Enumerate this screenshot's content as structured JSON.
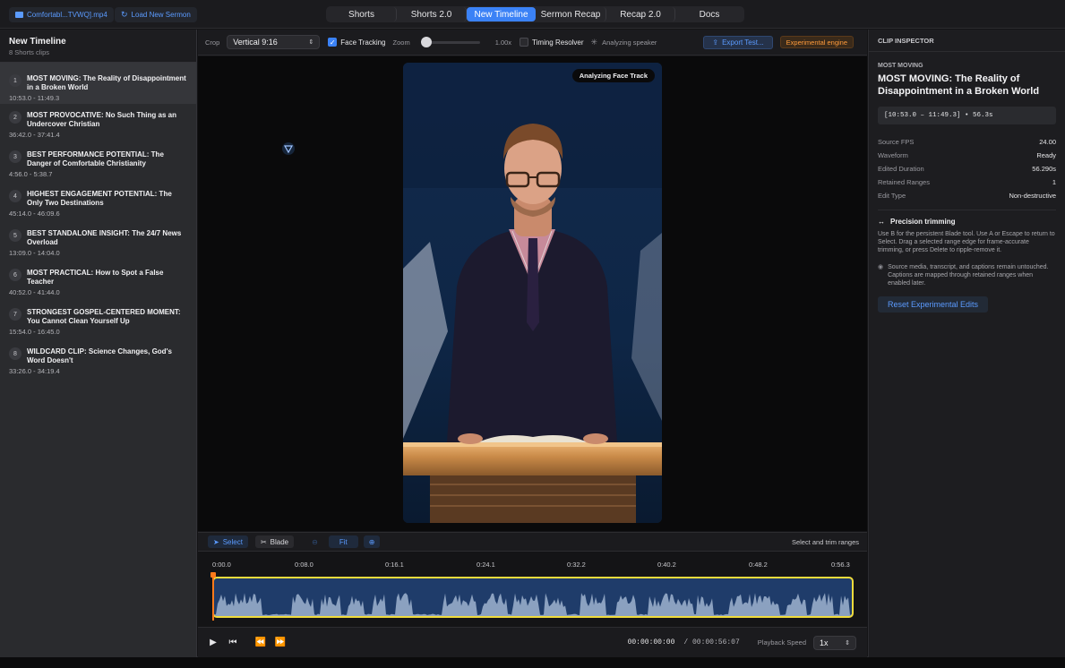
{
  "topbar": {
    "file_label": "Comfortabl...TVWQ].mp4",
    "load_label": "Load New Sermon",
    "tabs": [
      {
        "label": "Shorts"
      },
      {
        "label": "Shorts 2.0"
      },
      {
        "label": "New Timeline",
        "active": true
      },
      {
        "label": "Sermon Recap"
      },
      {
        "label": "Recap 2.0"
      },
      {
        "label": "Docs"
      }
    ]
  },
  "sidebar": {
    "title": "New Timeline",
    "subtitle": "8 Shorts clips",
    "clips": [
      {
        "num": "1",
        "title": "MOST MOVING: The Reality of Disappointment in a Broken World",
        "time": "10:53.0 - 11:49.3"
      },
      {
        "num": "2",
        "title": "MOST PROVOCATIVE: No Such Thing as an Undercover Christian",
        "time": "36:42.0 - 37:41.4"
      },
      {
        "num": "3",
        "title": "BEST PERFORMANCE POTENTIAL: The Danger of Comfortable Christianity",
        "time": "4:56.0 - 5:38.7"
      },
      {
        "num": "4",
        "title": "HIGHEST ENGAGEMENT POTENTIAL: The Only Two Destinations",
        "time": "45:14.0 - 46:09.6"
      },
      {
        "num": "5",
        "title": "BEST STANDALONE INSIGHT: The 24/7 News Overload",
        "time": "13:09.0 - 14:04.0"
      },
      {
        "num": "6",
        "title": "MOST PRACTICAL: How to Spot a False Teacher",
        "time": "40:52.0 - 41:44.0"
      },
      {
        "num": "7",
        "title": "STRONGEST GOSPEL-CENTERED MOMENT: You Cannot Clean Yourself Up",
        "time": "15:54.0 - 16:45.0"
      },
      {
        "num": "8",
        "title": "WILDCARD CLIP: Science Changes, God's Word Doesn't",
        "time": "33:26.0 - 34:19.4"
      }
    ]
  },
  "toolbar": {
    "crop_label": "Crop",
    "crop_value": "Vertical 9:16",
    "face_tracking_label": "Face Tracking",
    "face_tracking_checked": true,
    "zoom_label": "Zoom",
    "zoom_value": "1.00x",
    "zoom_level": 0.0,
    "timing_resolver_label": "Timing Resolver",
    "timing_resolver_checked": false,
    "analyzing_label": "Analyzing speaker",
    "export_label": "Export Test...",
    "engine_badge": "Experimental engine"
  },
  "video": {
    "overlay_tag": "Analyzing Face Track"
  },
  "timeline": {
    "select_label": "Select",
    "blade_label": "Blade",
    "fit_label": "Fit",
    "hint": "Select and trim ranges",
    "ticks": [
      "0:00.0",
      "0:08.0",
      "0:16.1",
      "0:24.1",
      "0:32.2",
      "0:40.2",
      "0:48.2",
      "0:56.3"
    ]
  },
  "transport": {
    "current_time": "00:00:00:00",
    "total_time": "/ 00:00:56:07",
    "speed_label": "Playback Speed",
    "speed_value": "1x"
  },
  "inspector": {
    "header": "CLIP INSPECTOR",
    "kicker": "MOST MOVING",
    "title": "MOST MOVING: The Reality of Disappointment in a Broken World",
    "range": "[10:53.0 – 11:49.3] • 56.3s",
    "props": [
      {
        "k": "Source FPS",
        "v": "24.00"
      },
      {
        "k": "Waveform",
        "v": "Ready"
      },
      {
        "k": "Edited Duration",
        "v": "56.290s"
      },
      {
        "k": "Retained Ranges",
        "v": "1"
      },
      {
        "k": "Edit Type",
        "v": "Non-destructive"
      }
    ],
    "precision_title": "Precision trimming",
    "precision_body": "Use B for the persistent Blade tool. Use A or Escape to return to Select. Drag a selected range edge for frame-accurate trimming, or press Delete to ripple-remove it.",
    "note": "Source media, transcript, and captions remain untouched. Captions are mapped through retained ranges when enabled later.",
    "reset_label": "Reset Experimental Edits"
  },
  "colors": {
    "accent": "#3b82f6",
    "clip_border": "#f0dc3c",
    "playhead": "#ff7a1a",
    "engine_badge": "#ff9b3b"
  }
}
